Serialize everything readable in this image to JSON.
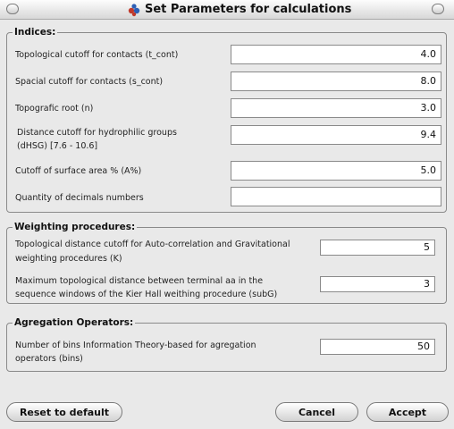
{
  "window": {
    "title": "Set Parameters for calculations"
  },
  "indices": {
    "title": "Indices:",
    "rows": [
      {
        "label": "Topological cutoff for contacts  (t_cont)",
        "value": "4.0"
      },
      {
        "label": "Spacial cutoff for contacts (s_cont)",
        "value": "8.0"
      },
      {
        "label": "Topografic root (n)",
        "value": "3.0"
      },
      {
        "label_line1": "Distance cutoff for hydrophilic groups",
        "label_line2": "(dHSG) [7.6 - 10.6]",
        "value": "9.4"
      },
      {
        "label": "Cutoff of surface area % (A%)",
        "value": "5.0"
      },
      {
        "label": "Quantity of decimals numbers",
        "value": ""
      }
    ]
  },
  "weighting": {
    "title": "Weighting procedures:",
    "rows": [
      {
        "label_line1": "Topological distance cutoff for Auto-correlation and Gravitational",
        "label_line2": "weighting procedures (K)",
        "value": "5"
      },
      {
        "label_line1": "Maximum topological distance between terminal aa in the",
        "label_line2": "sequence windows of the Kier Hall weithing procedure (subG)",
        "value": "3"
      }
    ]
  },
  "aggregation": {
    "title": "Agregation Operators:",
    "rows": [
      {
        "label_line1": "Number of bins Information Theory-based for agregation",
        "label_line2": "operators (bins)",
        "value": "50"
      }
    ]
  },
  "buttons": {
    "reset": "Reset to default",
    "cancel": "Cancel",
    "accept": "Accept"
  }
}
